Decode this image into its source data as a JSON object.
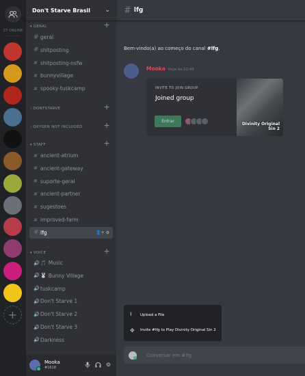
{
  "guilds": {
    "online_count": "27 ONLINE",
    "servers": [
      {
        "color": "#c0352d"
      },
      {
        "color": "#d49a1e"
      },
      {
        "color": "#b0261c"
      },
      {
        "color": "#4a6f91"
      },
      {
        "color": "#111111"
      },
      {
        "color": "#8a5a2b"
      },
      {
        "color": "#9aa83c"
      },
      {
        "color": "#6b6f77"
      },
      {
        "color": "#b83b4c"
      },
      {
        "color": "#8e3b6e"
      },
      {
        "color": "#c91e7a"
      },
      {
        "color": "#5b4fc8"
      },
      {
        "color": "#f0c419"
      }
    ]
  },
  "server": {
    "name": "Don't Starve Brasil"
  },
  "categories": [
    {
      "name": "GERAL"
    },
    {
      "name": "DONTSTARVE"
    },
    {
      "name": "OXYGEN NOT INCLUDED"
    },
    {
      "name": "STAFF"
    },
    {
      "name": "VOICE"
    }
  ],
  "channels": {
    "geral": [
      {
        "name": "geral",
        "icon": "#"
      },
      {
        "name": "shitposting",
        "icon": "#"
      },
      {
        "name": "shitposting-nsfw",
        "icon": "🔒"
      },
      {
        "name": "bunnyvillage",
        "icon": "🔒"
      },
      {
        "name": "spooky-tuskcamp",
        "icon": "🔒"
      }
    ],
    "staff": [
      {
        "name": "ancient-atrium",
        "icon": "🔒"
      },
      {
        "name": "ancient-gateway",
        "icon": "🔒"
      },
      {
        "name": "suporte-geral",
        "icon": "🔒"
      },
      {
        "name": "ancient-partner",
        "icon": "🔒"
      },
      {
        "name": "sugestoes",
        "icon": "🔒"
      },
      {
        "name": "improved-farm",
        "icon": "🔒"
      },
      {
        "name": "lfg",
        "icon": "#"
      }
    ],
    "voice": [
      {
        "name": "Music",
        "icon": "🔊",
        "emoji": "🎵"
      },
      {
        "name": "Bunny Village",
        "icon": "🔊",
        "emoji": "🐰"
      },
      {
        "name": "tuskcamp",
        "icon": "🔊"
      },
      {
        "name": "Don't Starve 1",
        "icon": "🔊"
      },
      {
        "name": "Don't Starve 2",
        "icon": "🔊"
      },
      {
        "name": "Don't Starve 3",
        "icon": "🔊"
      },
      {
        "name": "Darkness",
        "icon": "🔊"
      }
    ]
  },
  "user": {
    "name": "Mooka",
    "tag": "#1618"
  },
  "channel_header": {
    "name": "lfg"
  },
  "welcome": {
    "prefix": "Bem-vindo(a) ao começo do canal ",
    "channel": "#lfg",
    "suffix": "."
  },
  "message": {
    "author": "Mooka",
    "timestamp": "Hoje às 21:48",
    "invite": {
      "label": "INVITE TO JOIN GROUP",
      "title": "Joined group",
      "button": "Entrar",
      "game": "Divinity Original Sin 2"
    }
  },
  "upload_menu": {
    "upload_file": "Upload a File",
    "invite_play": "Invite #lfg to Play Divinity Original Sin 2"
  },
  "input": {
    "placeholder": "Conversar em #lfg"
  }
}
